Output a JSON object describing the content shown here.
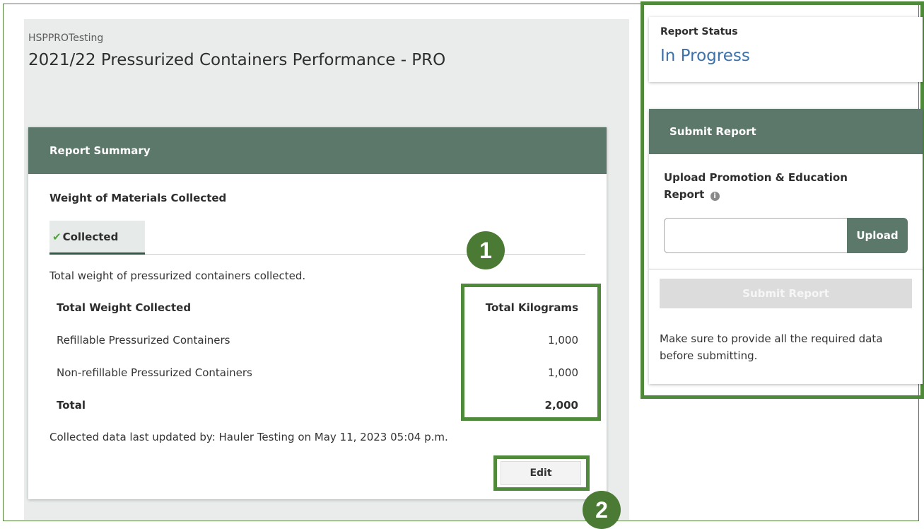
{
  "header": {
    "org_name": "HSPPROTesting",
    "page_title": "2021/22 Pressurized Containers Performance - PRO"
  },
  "summary": {
    "card_title": "Report Summary",
    "section_title": "Weight of Materials Collected",
    "tabs": [
      {
        "label": "Collected",
        "active": true,
        "icon": "check-icon"
      }
    ],
    "description": "Total weight of pressurized containers collected.",
    "table": {
      "headers": [
        "Total Weight Collected",
        "Total Kilograms"
      ],
      "rows": [
        [
          "Refillable Pressurized Containers",
          "1,000"
        ],
        [
          "Non-refillable Pressurized Containers",
          "1,000"
        ]
      ],
      "total": [
        "Total",
        "2,000"
      ]
    },
    "last_updated": "Collected data last updated by: Hauler Testing on  May 11, 2023 05:04 p.m.",
    "edit_label": "Edit"
  },
  "annotations": {
    "marker_1": "1",
    "marker_2": "2"
  },
  "sidebar": {
    "status_label": "Report Status",
    "status_value": "In Progress",
    "submit_card_title": "Submit Report",
    "upload_label": "Upload Promotion & Education Report",
    "info_icon": "info-icon",
    "upload_placeholder": "",
    "upload_button": "Upload",
    "submit_button": "Submit Report",
    "submit_enabled": false,
    "help_text": "Make sure to provide all the required data before submitting."
  },
  "colors": {
    "header_green": "#5c786a",
    "highlight_green": "#4f8a3a",
    "marker_green": "#4a7a33",
    "status_blue": "#3c71ac",
    "check_green": "#4caa3a"
  }
}
